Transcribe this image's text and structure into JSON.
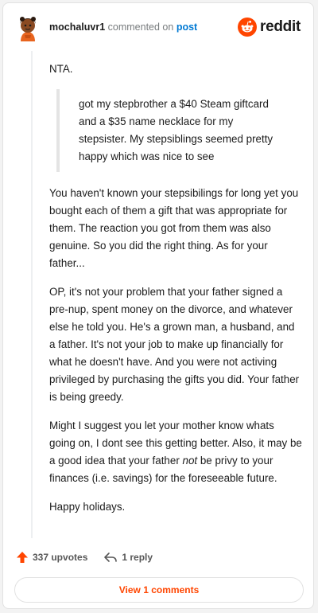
{
  "header": {
    "username": "mochaluvr1",
    "commented_text": "commented on",
    "post_link": "post",
    "brand_name": "reddit",
    "avatar_icon": "avatar-icon",
    "brand_icon": "reddit-logo-icon"
  },
  "comment": {
    "greeting": "NTA.",
    "quote": "got my stepbrother a $40 Steam giftcard and a $35 name necklace for my stepsister. My stepsiblings seemed pretty happy which was nice to see",
    "para1": "You haven't known your stepsibilings for long yet you bought each of them a gift that was appropriate for them. The reaction you got from them was also genuine. So you did the right thing. As for your father...",
    "para2": "OP, it's not your problem that your father signed a pre-nup, spent money on the divorce, and whatever else he told you. He's a grown man, a husband, and a father. It's not your job to make up financially for what he doesn't have. And you were not activing privileged by purchasing the gifts you did. Your father is being greedy.",
    "para3_before": "Might I suggest you let your mother know whats going on, I dont see this getting better. Also, it may be a good idea that your father ",
    "para3_em": "not",
    "para3_after": " be privy to your finances (i.e. savings) for the foreseeable future.",
    "closing": "Happy holidays."
  },
  "actions": {
    "upvotes": "337 upvotes",
    "reply": "1 reply",
    "upvote_icon": "upvote-arrow-icon",
    "reply_icon": "reply-arrow-icon",
    "upvote_color": "#ff4500"
  },
  "footer": {
    "view_comments": "View 1 comments"
  },
  "colors": {
    "accent": "#ff4500",
    "link": "#0079d3"
  }
}
